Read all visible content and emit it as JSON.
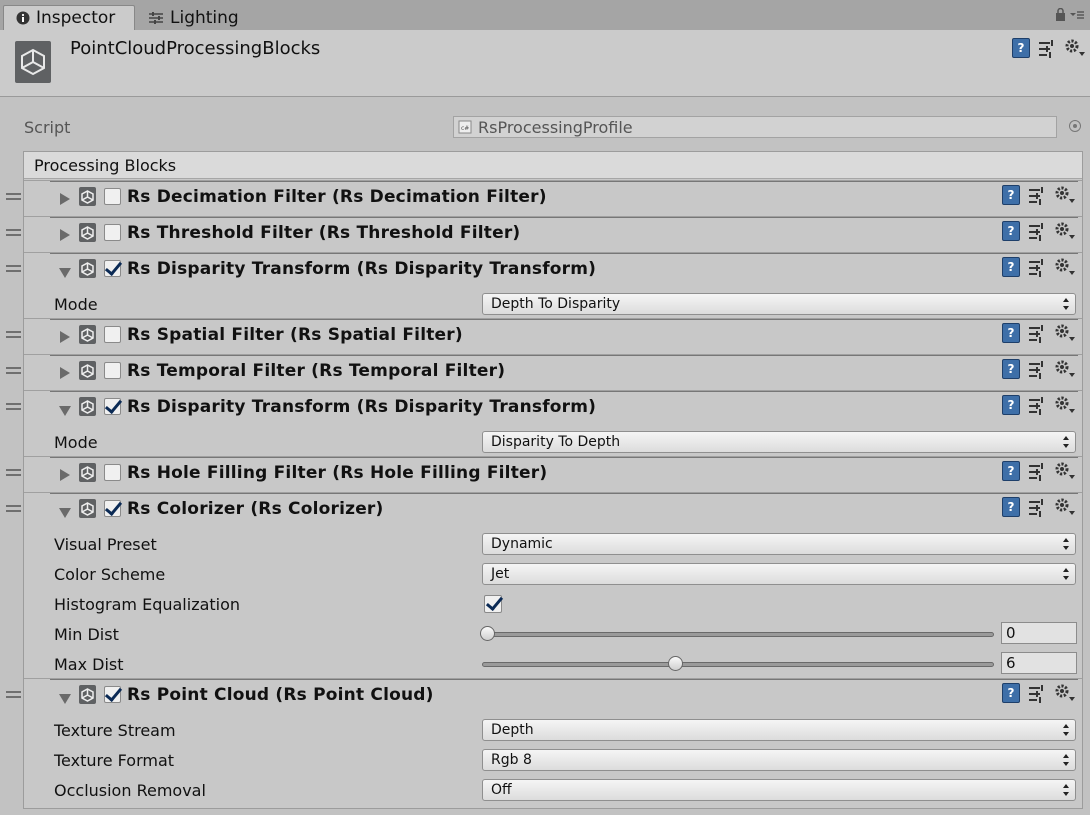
{
  "tabs": {
    "inspector": "Inspector",
    "lighting": "Lighting"
  },
  "header": {
    "title": "PointCloudProcessingBlocks"
  },
  "script": {
    "label": "Script",
    "value": "RsProcessingProfile"
  },
  "processing_blocks": {
    "label": "Processing Blocks",
    "blocks": [
      {
        "title": "Rs Decimation Filter (Rs Decimation Filter)",
        "enabled": false,
        "expanded": false
      },
      {
        "title": "Rs Threshold Filter (Rs Threshold Filter)",
        "enabled": false,
        "expanded": false
      },
      {
        "title": "Rs Disparity Transform (Rs Disparity Transform)",
        "enabled": true,
        "expanded": true,
        "fields": [
          {
            "label": "Mode",
            "type": "dropdown",
            "value": "Depth To Disparity"
          }
        ]
      },
      {
        "title": "Rs Spatial Filter (Rs Spatial Filter)",
        "enabled": false,
        "expanded": false
      },
      {
        "title": "Rs Temporal Filter (Rs Temporal Filter)",
        "enabled": false,
        "expanded": false
      },
      {
        "title": "Rs Disparity Transform (Rs Disparity Transform)",
        "enabled": true,
        "expanded": true,
        "fields": [
          {
            "label": "Mode",
            "type": "dropdown",
            "value": "Disparity To Depth"
          }
        ]
      },
      {
        "title": "Rs Hole Filling Filter (Rs Hole Filling Filter)",
        "enabled": false,
        "expanded": false
      },
      {
        "title": "Rs Colorizer (Rs Colorizer)",
        "enabled": true,
        "expanded": true,
        "fields": [
          {
            "label": "Visual Preset",
            "type": "dropdown",
            "value": "Dynamic"
          },
          {
            "label": "Color Scheme",
            "type": "dropdown",
            "value": "Jet"
          },
          {
            "label": "Histogram Equalization",
            "type": "checkbox",
            "checked": true
          },
          {
            "label": "Min Dist",
            "type": "slider",
            "value": "0",
            "fraction": 0.0
          },
          {
            "label": "Max Dist",
            "type": "slider",
            "value": "6",
            "fraction": 0.375
          }
        ]
      },
      {
        "title": "Rs Point Cloud (Rs Point Cloud)",
        "enabled": true,
        "expanded": true,
        "fields": [
          {
            "label": "Texture Stream",
            "type": "dropdown",
            "value": "Depth"
          },
          {
            "label": "Texture Format",
            "type": "dropdown",
            "value": "Rgb 8"
          },
          {
            "label": "Occlusion Removal",
            "type": "dropdown",
            "value": "Off"
          }
        ]
      }
    ]
  },
  "icons": {
    "help": "help-icon",
    "preset": "preset-icon",
    "gear": "gear-icon",
    "lock": "lock-icon",
    "menu": "menu-icon",
    "unity": "unity-icon",
    "info": "info-icon",
    "lighting": "lighting-icon",
    "object_picker": "object-picker-icon",
    "script_file": "script-file-icon"
  }
}
